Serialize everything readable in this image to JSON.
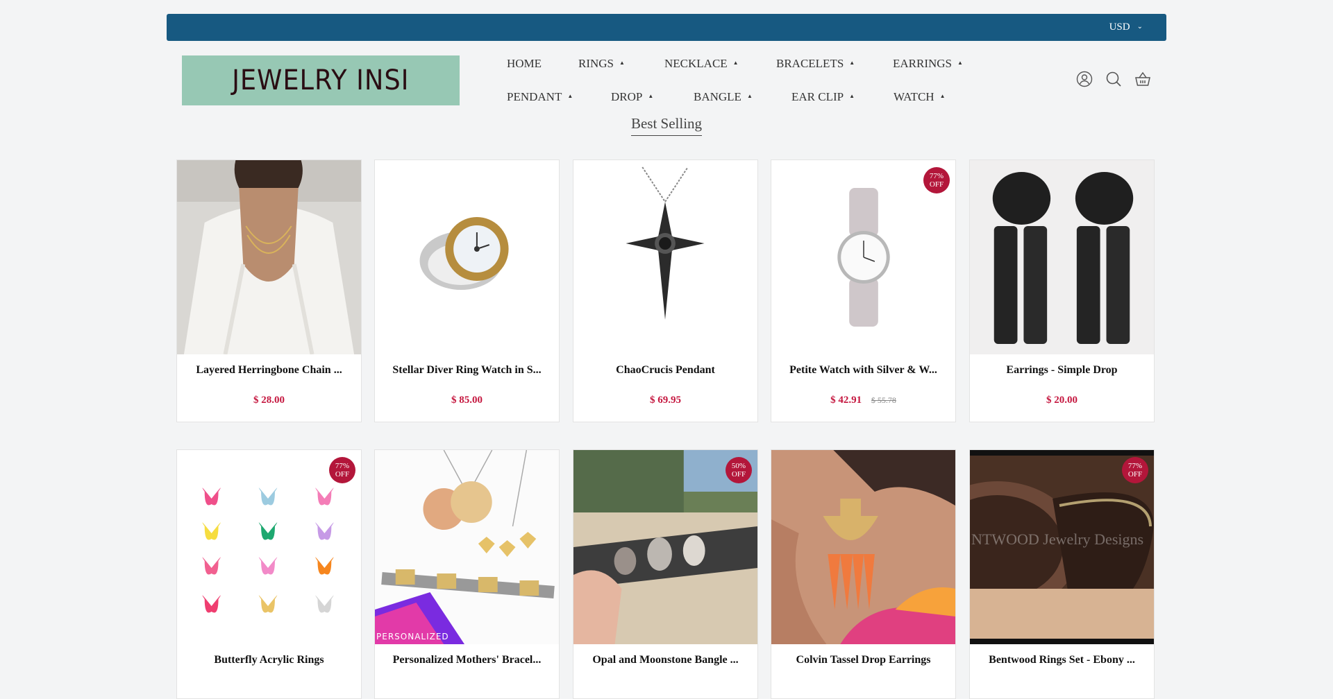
{
  "topbar": {
    "currency": "USD"
  },
  "logo": {
    "text": "JEWELRY INSI"
  },
  "nav": {
    "row1": [
      "HOME",
      "RINGS",
      "NECKLACE",
      "BRACELETS",
      "EARRINGS"
    ],
    "row2": [
      "PENDANT",
      "DROP",
      "BANGLE",
      "EAR CLIP",
      "WATCH"
    ]
  },
  "header_icons": [
    "account-icon",
    "search-icon",
    "cart-icon"
  ],
  "section": {
    "title": "Best Selling"
  },
  "products": [
    {
      "name": "Layered Herringbone Chain ...",
      "price": "$ 28.00",
      "compare": "",
      "badge": ""
    },
    {
      "name": "Stellar Diver Ring Watch in S...",
      "price": "$ 85.00",
      "compare": "",
      "badge": ""
    },
    {
      "name": "ChaoCrucis Pendant",
      "price": "$ 69.95",
      "compare": "",
      "badge": ""
    },
    {
      "name": "Petite Watch with Silver & W...",
      "price": "$ 42.91",
      "compare": "$ 55.78",
      "badge": "77% OFF"
    },
    {
      "name": "Earrings - Simple Drop",
      "price": "$ 20.00",
      "compare": "",
      "badge": ""
    },
    {
      "name": "Butterfly Acrylic Rings",
      "price": "",
      "compare": "",
      "badge": "77% OFF"
    },
    {
      "name": "Personalized Mothers' Bracel...",
      "price": "",
      "compare": "",
      "badge": ""
    },
    {
      "name": "Opal and Moonstone Bangle ...",
      "price": "",
      "compare": "",
      "badge": "50% OFF"
    },
    {
      "name": "Colvin Tassel Drop Earrings",
      "price": "",
      "compare": "",
      "badge": ""
    },
    {
      "name": "Bentwood Rings Set - Ebony ...",
      "price": "",
      "compare": "",
      "badge": "77% OFF"
    }
  ],
  "image_text": {
    "personalized_banner": "PERSONALIZED",
    "watermark": "NTWOOD Jewelry Designs"
  },
  "colors": {
    "topbar": "#175981",
    "logo_bg": "#97c8b4",
    "price": "#c5173f",
    "badge": "#b3163a"
  }
}
